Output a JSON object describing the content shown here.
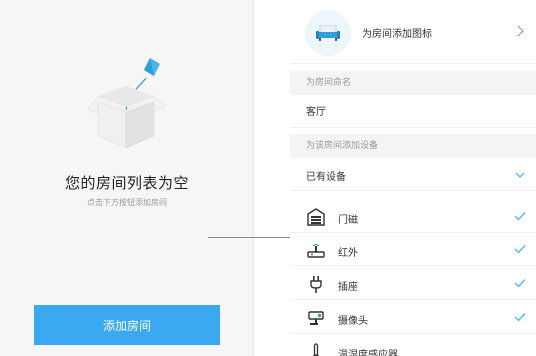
{
  "left_panel": {
    "empty_title": "您的房间列表为空",
    "empty_subtitle": "点击下方按钮添加房间",
    "add_button_label": "添加房间"
  },
  "right_panel": {
    "add_icon_label": "为房间添加图标",
    "name_section_label": "为房间命名",
    "room_name_value": "客厅",
    "device_section_label": "为该房间添加设备",
    "existing_devices_label": "已有设备",
    "devices": [
      {
        "label": "门磁",
        "icon": "door-sensor-icon",
        "checked": true
      },
      {
        "label": "红外",
        "icon": "infrared-icon",
        "checked": true
      },
      {
        "label": "插座",
        "icon": "plug-icon",
        "checked": true
      },
      {
        "label": "摄像头",
        "icon": "camera-icon",
        "checked": true
      },
      {
        "label": "温湿度感应器",
        "icon": "thermometer-icon",
        "checked": false
      }
    ]
  },
  "colors": {
    "accent": "#3aa9f0",
    "check": "#5bb8e8",
    "left_bg": "#f6f6f6"
  }
}
